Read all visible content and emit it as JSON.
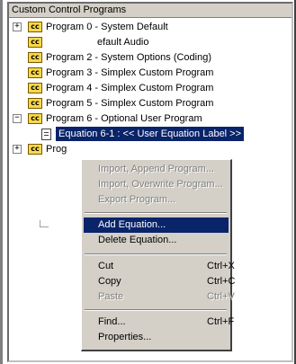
{
  "tree": {
    "header": "Custom Control Programs",
    "icon_text": "cc",
    "items": [
      {
        "label": "Program 0 - System Default",
        "expander": "+"
      },
      {
        "label": "efault Audio",
        "expander": ""
      },
      {
        "label": "Program 2 - System Options (Coding)",
        "expander": ""
      },
      {
        "label": "Program 3 - Simplex Custom Program",
        "expander": ""
      },
      {
        "label": "Program 4 - Simplex Custom Program",
        "expander": ""
      },
      {
        "label": "Program 5 - Simplex Custom Program",
        "expander": ""
      },
      {
        "label": "Program 6 - Optional User Program",
        "expander": "−"
      },
      {
        "label": "Equation 6-1 : << User Equation Label >>",
        "expander": ""
      },
      {
        "label": "Prog",
        "expander": "+"
      }
    ]
  },
  "context_menu": {
    "items": [
      {
        "label": "Import, Append Program...",
        "shortcut": "",
        "enabled": false
      },
      {
        "label": "Import, Overwrite Program...",
        "shortcut": "",
        "enabled": false
      },
      {
        "label": "Export Program...",
        "shortcut": "",
        "enabled": false
      },
      {
        "label": "Add Equation...",
        "shortcut": "",
        "enabled": true,
        "highlighted": true
      },
      {
        "label": "Delete Equation...",
        "shortcut": "",
        "enabled": true
      },
      {
        "label": "Cut",
        "shortcut": "Ctrl+X",
        "enabled": true
      },
      {
        "label": "Copy",
        "shortcut": "Ctrl+C",
        "enabled": true
      },
      {
        "label": "Paste",
        "shortcut": "Ctrl+V",
        "enabled": false
      },
      {
        "label": "Find...",
        "shortcut": "Ctrl+F",
        "enabled": true
      },
      {
        "label": "Properties...",
        "shortcut": "",
        "enabled": true
      }
    ]
  },
  "colors": {
    "selection": "#0a246a",
    "menu_bg": "#d4d0c8",
    "icon": "#f7d84a"
  }
}
